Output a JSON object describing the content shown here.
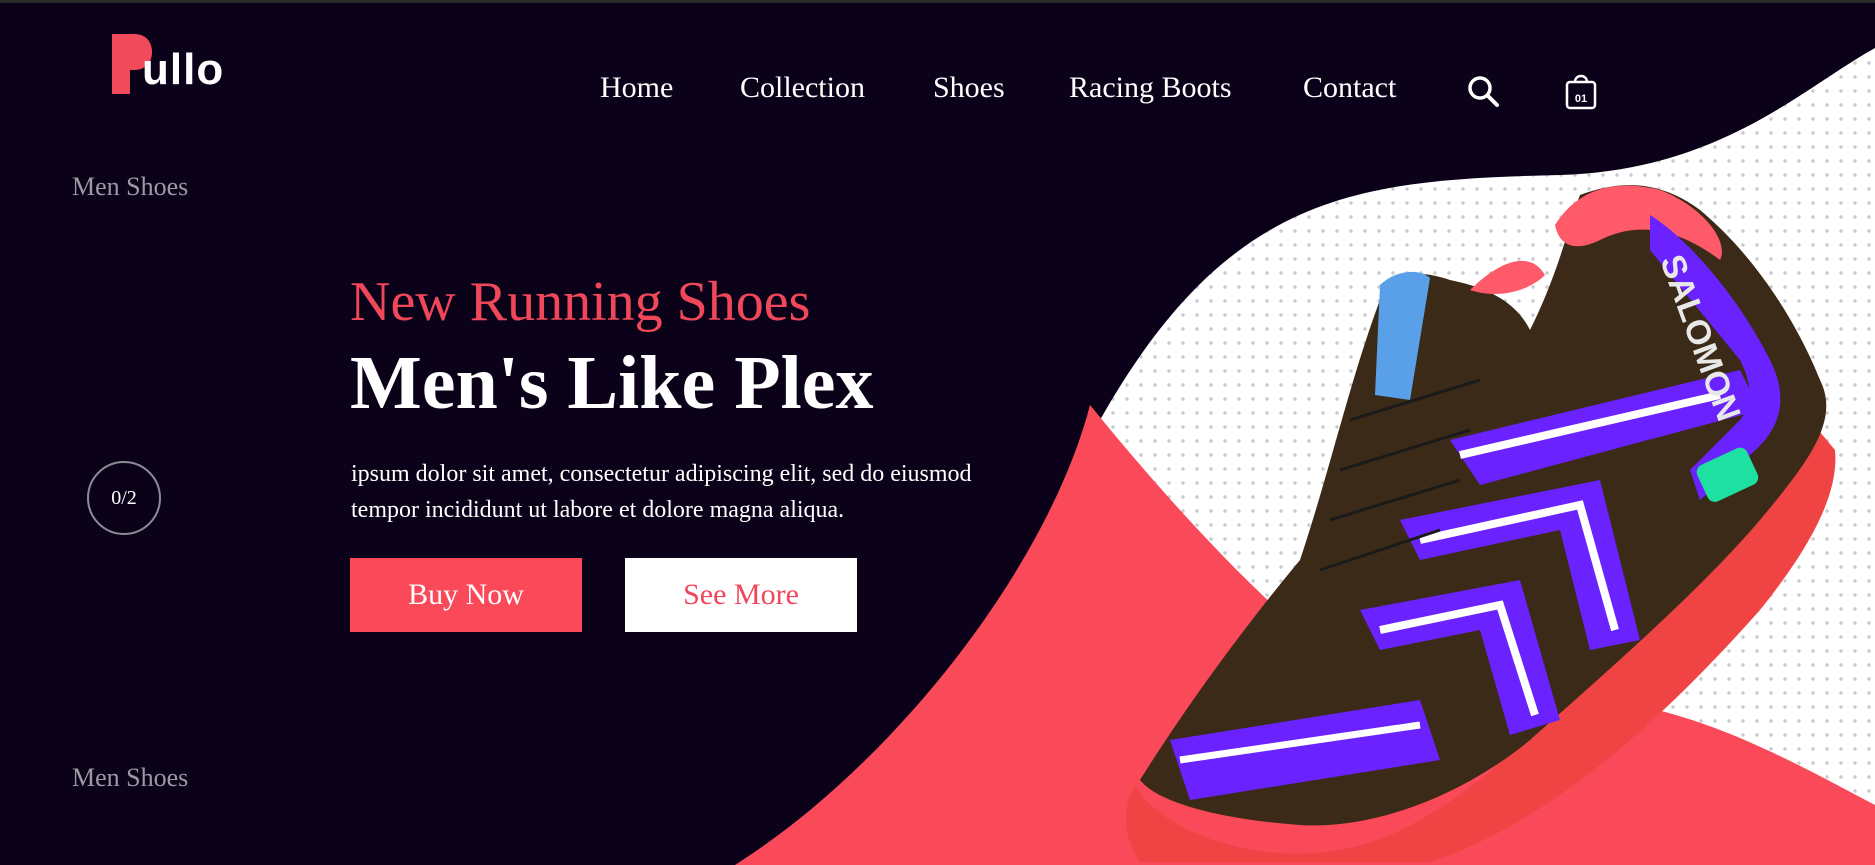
{
  "brand": {
    "name": "ullo",
    "accent": "#f04a5b"
  },
  "nav": {
    "items": [
      {
        "label": "Home"
      },
      {
        "label": "Collection"
      },
      {
        "label": "Shoes"
      },
      {
        "label": "Racing Boots"
      },
      {
        "label": "Contact"
      }
    ],
    "search_icon": "search-icon",
    "cart_icon": "shopping-bag-icon",
    "cart_count": "01"
  },
  "sidebar": {
    "top_label": "Men Shoes",
    "pager": "0/2",
    "bottom_label": "Men Shoes"
  },
  "hero": {
    "subtitle": "New Running Shoes",
    "title": "Men's Like Plex",
    "description": "ipsum dolor sit amet, consectetur adipiscing elit, sed do eiusmod tempor incididunt ut labore et dolore magna aliqua.",
    "primary_button": "Buy Now",
    "secondary_button": "See More"
  },
  "product": {
    "brand_text": "SALOMON",
    "icon": "running-shoe-image"
  },
  "colors": {
    "background": "#0b0219",
    "accent": "#fa4a5a",
    "shoe_purple": "#6a22ff",
    "shoe_body": "#3b2a17"
  }
}
